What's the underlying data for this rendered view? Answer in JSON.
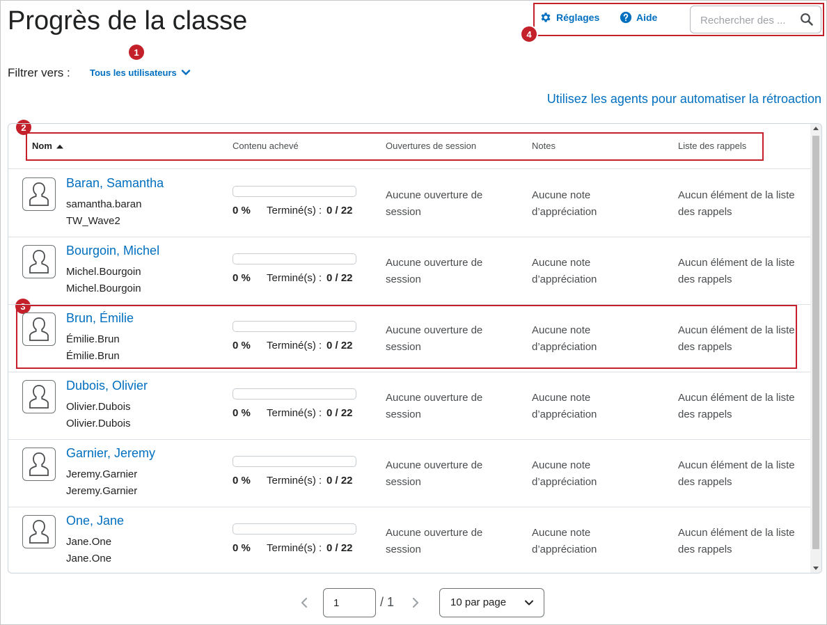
{
  "page": {
    "title": "Progrès de la classe"
  },
  "toolbar": {
    "settings_label": "Réglages",
    "help_label": "Aide",
    "search_placeholder": "Rechercher des ..."
  },
  "filter": {
    "label": "Filtrer vers :",
    "value": "Tous les utilisateurs"
  },
  "agents_link": "Utilisez les agents pour automatiser la rétroaction",
  "callouts": [
    "1",
    "2",
    "3",
    "4"
  ],
  "table": {
    "headers": {
      "name": "Nom",
      "content": "Contenu achevé",
      "sessions": "Ouvertures de session",
      "grades": "Notes",
      "checklist": "Liste des rappels"
    },
    "rows": [
      {
        "name": "Baran, Samantha",
        "line1": "samantha.baran",
        "line2": "TW_Wave2",
        "progress": 0,
        "pct": "0 %",
        "done_label": "Terminé(s) :",
        "done_value": "0 / 22",
        "sessions": "Aucune ouverture de session",
        "grades": "Aucune note d’appréciation",
        "checklist": "Aucun élément de la liste des rappels"
      },
      {
        "name": "Bourgoin, Michel",
        "line1": "Michel.Bourgoin",
        "line2": "Michel.Bourgoin",
        "progress": 0,
        "pct": "0 %",
        "done_label": "Terminé(s) :",
        "done_value": "0 / 22",
        "sessions": "Aucune ouverture de session",
        "grades": "Aucune note d’appréciation",
        "checklist": "Aucun élément de la liste des rappels"
      },
      {
        "name": "Brun, Émilie",
        "line1": "Émilie.Brun",
        "line2": "Émilie.Brun",
        "progress": 0,
        "pct": "0 %",
        "done_label": "Terminé(s) :",
        "done_value": "0 / 22",
        "sessions": "Aucune ouverture de session",
        "grades": "Aucune note d’appréciation",
        "checklist": "Aucun élément de la liste des rappels"
      },
      {
        "name": "Dubois, Olivier",
        "line1": "Olivier.Dubois",
        "line2": "Olivier.Dubois",
        "progress": 0,
        "pct": "0 %",
        "done_label": "Terminé(s) :",
        "done_value": "0 / 22",
        "sessions": "Aucune ouverture de session",
        "grades": "Aucune note d’appréciation",
        "checklist": "Aucun élément de la liste des rappels"
      },
      {
        "name": "Garnier, Jeremy",
        "line1": "Jeremy.Garnier",
        "line2": "Jeremy.Garnier",
        "progress": 0,
        "pct": "0 %",
        "done_label": "Terminé(s) :",
        "done_value": "0 / 22",
        "sessions": "Aucune ouverture de session",
        "grades": "Aucune note d’appréciation",
        "checklist": "Aucun élément de la liste des rappels"
      },
      {
        "name": "One, Jane",
        "line1": "Jane.One",
        "line2": "Jane.One",
        "progress": 0,
        "pct": "0 %",
        "done_label": "Terminé(s) :",
        "done_value": "0 / 22",
        "sessions": "Aucune ouverture de session",
        "grades": "Aucune note d’appréciation",
        "checklist": "Aucun élément de la liste des rappels"
      }
    ]
  },
  "pagination": {
    "current_page": "1",
    "total": "/ 1",
    "per_page": "10 par page"
  },
  "colors": {
    "accent": "#006fbf",
    "callout": "#c4202a"
  },
  "icons": [
    "gear-icon",
    "help-icon",
    "search-icon",
    "chevron-down-icon",
    "sort-ascending-icon",
    "user-avatar-icon",
    "chevron-left-icon",
    "chevron-right-icon"
  ]
}
